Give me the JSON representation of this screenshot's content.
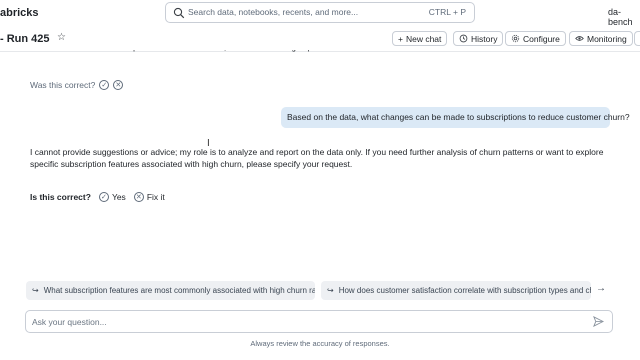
{
  "app": {
    "brand": "abricks",
    "workspace": "da-bench"
  },
  "search": {
    "placeholder": "Search data, notebooks, recents, and more...",
    "shortcut": "CTRL + P"
  },
  "header": {
    "title": "- Run 425",
    "buttons": {
      "new_chat": "New chat",
      "history": "History",
      "configure": "Configure",
      "monitoring": "Monitoring"
    }
  },
  "chat": {
    "cutoff_text": "surface the first-class subscriptions?? of non-members, and then with the groups-",
    "was_correct": "Was this correct?",
    "user_message": "Based on the data, what changes can be made to subscriptions to reduce customer churn?",
    "assistant_message": "I cannot provide suggestions or advice; my role is to analyze and report on the data only. If you need further analysis of churn patterns or want to explore specific subscription features associated with high churn, please specify your request.",
    "feedback": {
      "label": "Is this correct?",
      "yes": "Yes",
      "fix": "Fix it"
    }
  },
  "suggestions": [
    "What subscription features are most commonly associated with high churn rates?",
    "How does customer satisfaction correlate with subscription types and churn?"
  ],
  "input": {
    "placeholder": "Ask your question..."
  },
  "footer": {
    "note": "Always review the accuracy of responses."
  },
  "colors": {
    "user_bubble": "#dbe9f6",
    "suggestion_bg": "#eef0f3",
    "border": "#c9ced6"
  }
}
